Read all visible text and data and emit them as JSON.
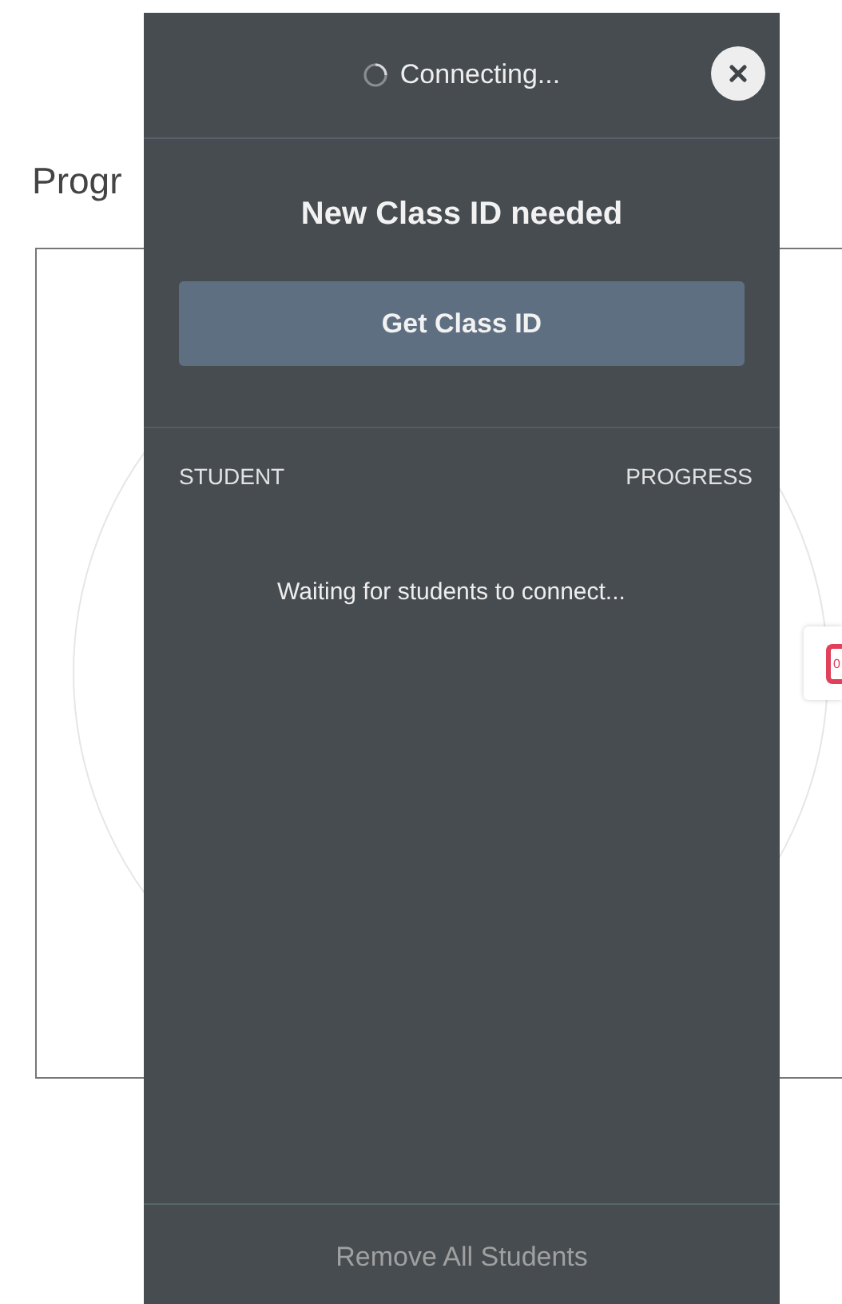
{
  "page": {
    "title": "Progr",
    "badge": "0"
  },
  "panel": {
    "status": "Connecting...",
    "heading": "New Class ID needed",
    "button": "Get Class ID",
    "columns": [
      "STUDENT",
      "PROGRESS"
    ],
    "empty_message": "Waiting for students to connect...",
    "footer_button": "Remove All Students"
  }
}
